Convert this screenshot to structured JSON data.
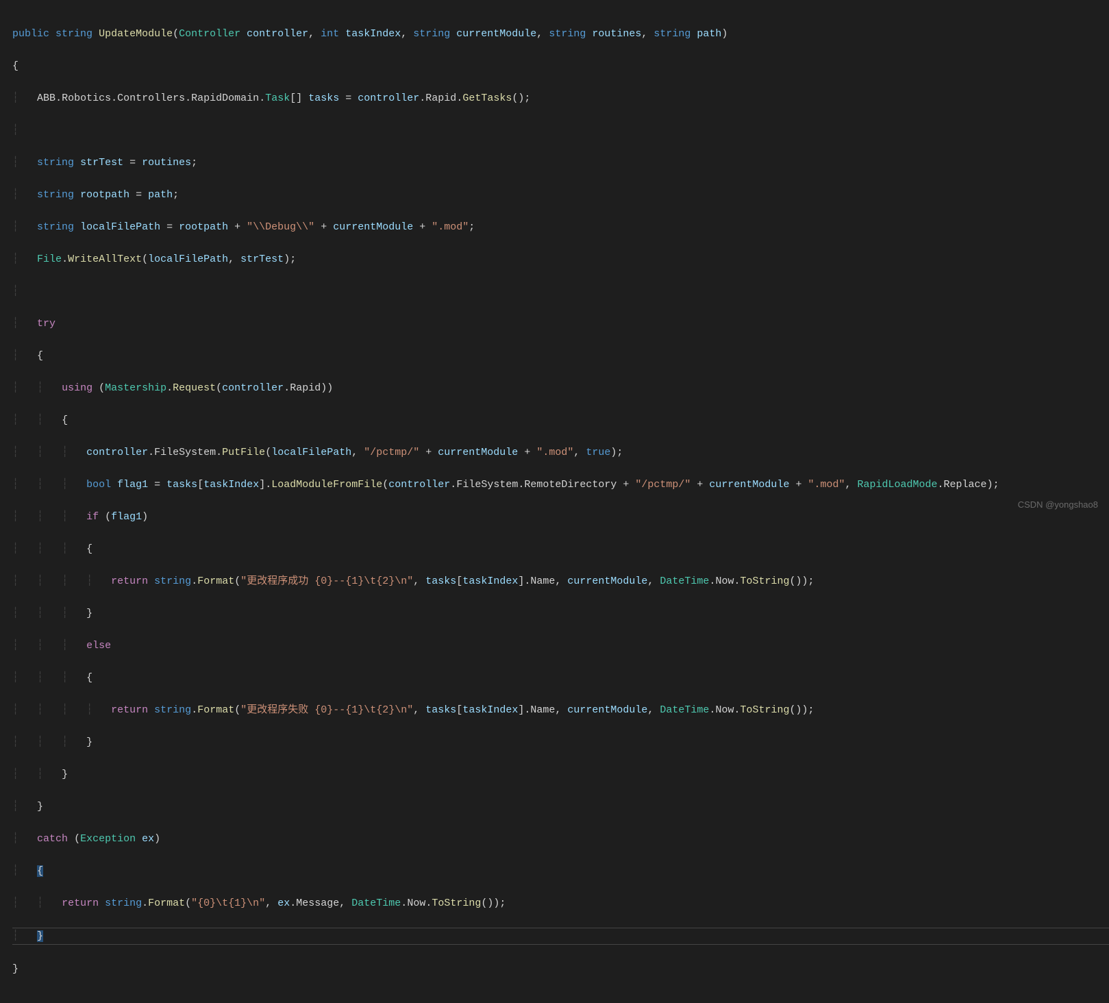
{
  "watermark": "CSDN @yongshao8",
  "code": {
    "keywords": {
      "public": "public",
      "string": "string",
      "int": "int",
      "bool": "bool",
      "try": "try",
      "catch": "catch",
      "if": "if",
      "else": "else",
      "using": "using",
      "return": "return",
      "true": "true"
    },
    "types": {
      "Controller": "Controller",
      "Task": "Task",
      "File": "File",
      "Mastership": "Mastership",
      "RapidLoadMode": "RapidLoadMode",
      "Exception": "Exception",
      "DateTime": "DateTime"
    },
    "methods": {
      "UpdateModule": "UpdateModule",
      "GetTasks": "GetTasks",
      "WriteAllText": "WriteAllText",
      "Request": "Request",
      "PutFile": "PutFile",
      "LoadModuleFromFile": "LoadModuleFromFile",
      "Format": "Format",
      "ToString": "ToString"
    },
    "vars": {
      "controller": "controller",
      "taskIndex": "taskIndex",
      "currentModule": "currentModule",
      "routines": "routines",
      "path": "path",
      "tasks": "tasks",
      "strTest": "strTest",
      "rootpath": "rootpath",
      "localFilePath": "localFilePath",
      "flag1": "flag1",
      "ex": "ex"
    },
    "members": {
      "ABB": "ABB",
      "Robotics": "Robotics",
      "Controllers": "Controllers",
      "RapidDomain": "RapidDomain",
      "Rapid": "Rapid",
      "FileSystem": "FileSystem",
      "RemoteDirectory": "RemoteDirectory",
      "Name": "Name",
      "Now": "Now",
      "Replace": "Replace",
      "Message": "Message"
    },
    "strings": {
      "debug": "\"\\\\Debug\\\\\"",
      "mod": "\".mod\"",
      "pctmp": "\"/pctmp/\"",
      "success": "\"更改程序成功 {0}--{1}\\t{2}\\n\"",
      "fail": "\"更改程序失败 {0}--{1}\\t{2}\\n\"",
      "catchfmt": "\"{0}\\t{1}\\n\""
    }
  }
}
